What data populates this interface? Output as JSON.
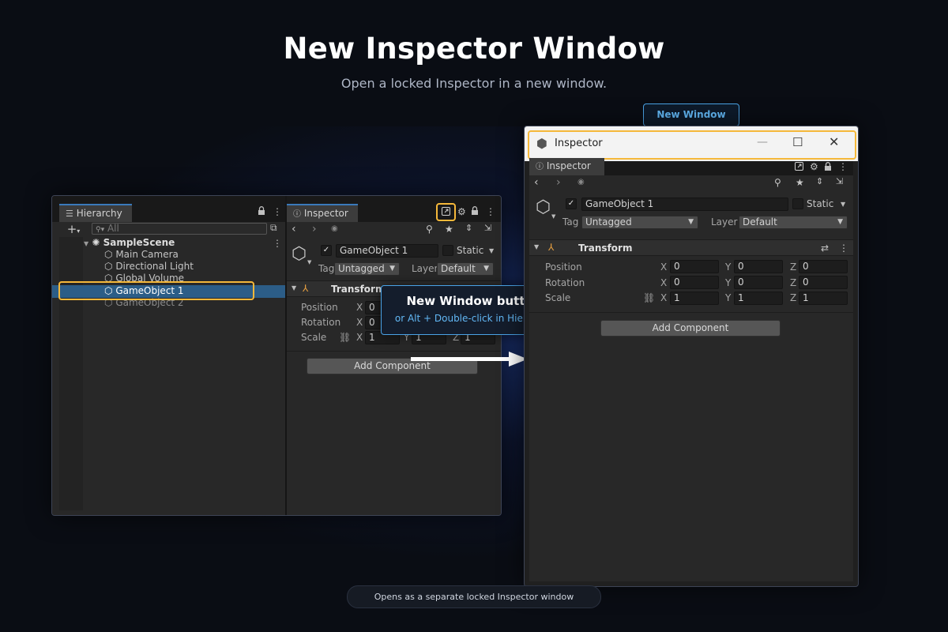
{
  "header": {
    "title": "New Inspector Window",
    "subtitle": "Open a locked Inspector in a new window."
  },
  "badge": {
    "label": "New Window"
  },
  "hierarchy": {
    "tab": "Hierarchy",
    "search_placeholder": "All",
    "scene": "SampleScene",
    "items": [
      "Main Camera",
      "Directional Light",
      "Global Volume",
      "GameObject 1",
      "GameObject 2"
    ],
    "selected_index": 3
  },
  "inspector": {
    "tab": "Inspector",
    "object_name": "GameObject 1",
    "static_label": "Static",
    "tag_label": "Tag",
    "tag_value": "Untagged",
    "layer_label": "Layer",
    "layer_value": "Default",
    "component_title": "Transform",
    "position_label": "Position",
    "rotation_label": "Rotation",
    "scale_label": "Scale",
    "x": "X",
    "y": "Y",
    "z": "Z",
    "position": [
      "0",
      "0",
      "0"
    ],
    "rotation": [
      "0",
      "0",
      "0"
    ],
    "scale": [
      "1",
      "1",
      "1"
    ],
    "add_component": "Add Component"
  },
  "tooltip": {
    "title": "New Window button",
    "subtitle": "or Alt + Double-click in Hierarchy"
  },
  "window": {
    "title": "Inspector"
  },
  "footer": {
    "note": "Opens as a separate locked Inspector window"
  },
  "colors": {
    "accent_blue": "#4aa3e6",
    "highlight_orange": "#f5b83a",
    "selection": "#2c5d87",
    "panel_bg": "#282828"
  }
}
